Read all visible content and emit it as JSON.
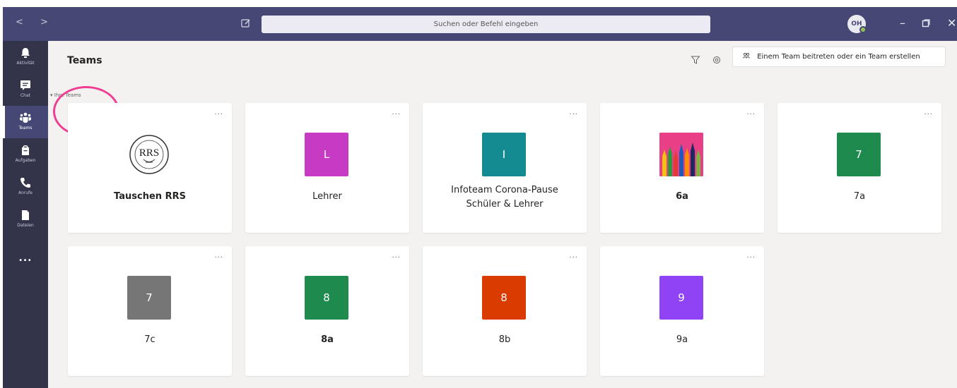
{
  "titlebar": {
    "search_placeholder": "Suchen oder Befehl eingeben",
    "avatar_initials": "OH",
    "nav_arrows": "< >"
  },
  "rail": {
    "items": [
      {
        "label": "Aktivität",
        "icon": "bell-icon"
      },
      {
        "label": "Chat",
        "icon": "chat-icon"
      },
      {
        "label": "Teams",
        "icon": "teams-icon",
        "active": true
      },
      {
        "label": "Aufgaben",
        "icon": "assignments-icon"
      },
      {
        "label": "Anrufe",
        "icon": "phone-icon"
      },
      {
        "label": "Dateien",
        "icon": "files-icon"
      }
    ],
    "more": "..."
  },
  "header": {
    "title": "Teams",
    "join_button": "Einem Team beitreten oder ein Team erstellen"
  },
  "section": {
    "label": "Ihre Teams"
  },
  "teams": [
    {
      "name": "Tauschen RRS",
      "tile": "",
      "color": "#ffffff",
      "bold": true,
      "logo": "RRS"
    },
    {
      "name": "Lehrer",
      "tile": "L",
      "color": "#c73ac4",
      "bold": false
    },
    {
      "name": "Infoteam Corona-Pause Schüler & Lehrer",
      "tile": "I",
      "color": "#138b91",
      "bold": false
    },
    {
      "name": "6a",
      "tile": "",
      "color": "#e83f87",
      "bold": true,
      "image": "colored-pencils"
    },
    {
      "name": "7a",
      "tile": "7",
      "color": "#1e8a4e",
      "bold": false
    },
    {
      "name": "7c",
      "tile": "7",
      "color": "#767676",
      "bold": false
    },
    {
      "name": "8a",
      "tile": "8",
      "color": "#1e8a4e",
      "bold": true
    },
    {
      "name": "8b",
      "tile": "8",
      "color": "#da3b01",
      "bold": false
    },
    {
      "name": "9a",
      "tile": "9",
      "color": "#8f43f5",
      "bold": false
    }
  ],
  "card_more": "..."
}
